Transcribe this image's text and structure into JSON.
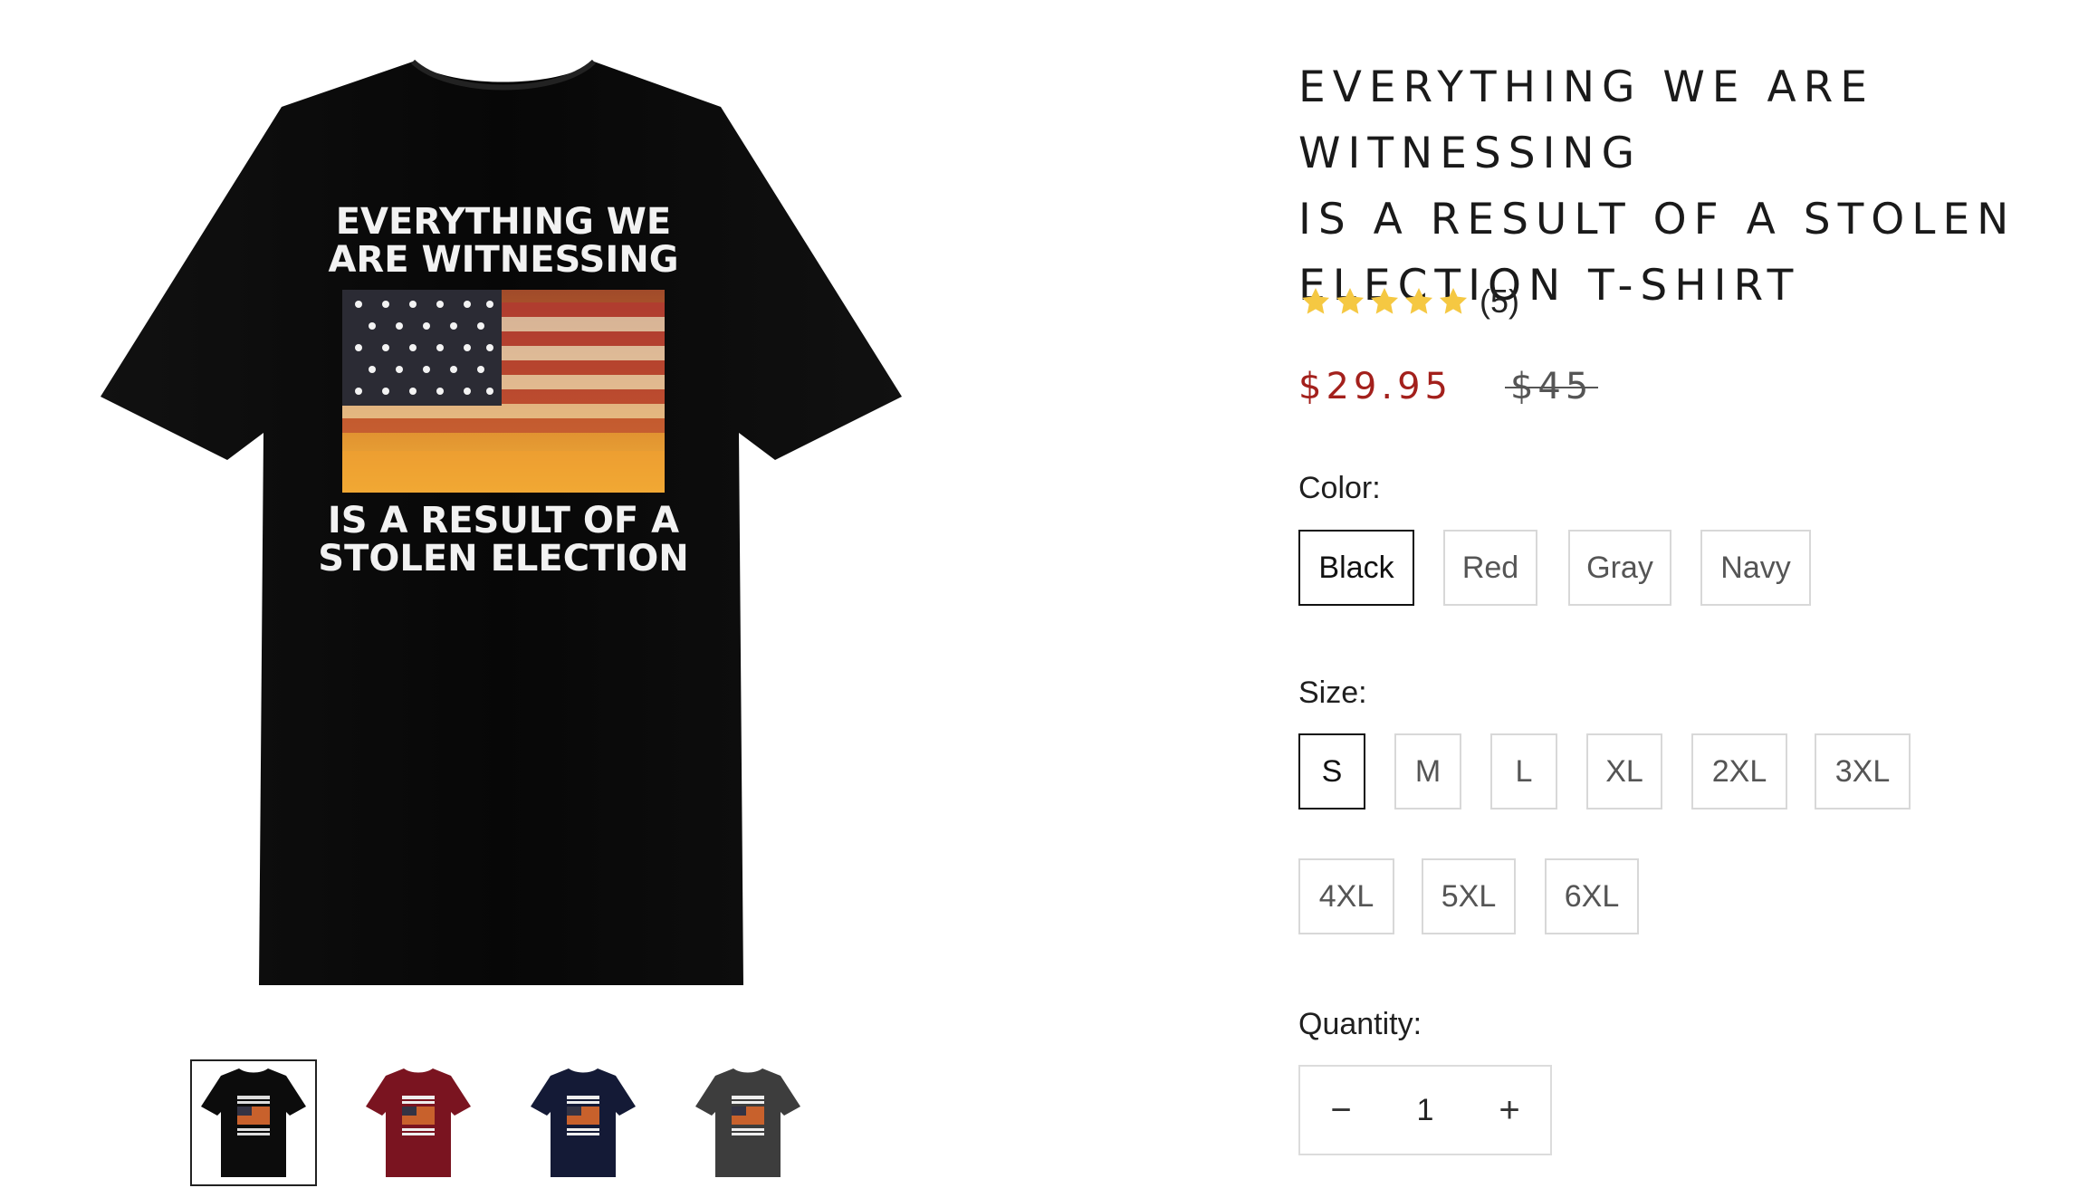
{
  "product": {
    "title": "EVERYTHING WE ARE WITNESSING IS A RESULT OF A STOLEN ELECTION T-SHIRT",
    "title_lines": [
      "EVERYTHING WE ARE WITNESSING",
      "IS A RESULT OF A STOLEN",
      "ELECTION T-SHIRT"
    ],
    "rating": {
      "stars": 5,
      "count_label": "(5)"
    },
    "sale_price": "$29.95",
    "compare_price": "$45",
    "sale_color": "#a3201c",
    "star_color": "#f5c842"
  },
  "artwork": {
    "line1": "EVERYTHING WE",
    "line2": "ARE WITNESSING",
    "line3": "IS A RESULT OF A",
    "line4": "STOLEN ELECTION"
  },
  "gallery": {
    "thumbnails": [
      {
        "name": "thumb-black",
        "shirt_color": "#0c0c0c",
        "selected": true
      },
      {
        "name": "thumb-red",
        "shirt_color": "#7a1420",
        "selected": false
      },
      {
        "name": "thumb-navy",
        "shirt_color": "#141a36",
        "selected": false
      },
      {
        "name": "thumb-gray",
        "shirt_color": "#3d3d3d",
        "selected": false
      }
    ]
  },
  "options": {
    "color_label": "Color:",
    "colors": [
      {
        "label": "Black",
        "selected": true
      },
      {
        "label": "Red",
        "selected": false
      },
      {
        "label": "Gray",
        "selected": false
      },
      {
        "label": "Navy",
        "selected": false
      }
    ],
    "size_label": "Size:",
    "sizes": [
      {
        "label": "S",
        "selected": true
      },
      {
        "label": "M",
        "selected": false
      },
      {
        "label": "L",
        "selected": false
      },
      {
        "label": "XL",
        "selected": false
      },
      {
        "label": "2XL",
        "selected": false
      },
      {
        "label": "3XL",
        "selected": false
      },
      {
        "label": "4XL",
        "selected": false
      },
      {
        "label": "5XL",
        "selected": false
      },
      {
        "label": "6XL",
        "selected": false
      }
    ],
    "quantity_label": "Quantity:",
    "quantity_value": "1",
    "minus_symbol": "−",
    "plus_symbol": "+"
  }
}
